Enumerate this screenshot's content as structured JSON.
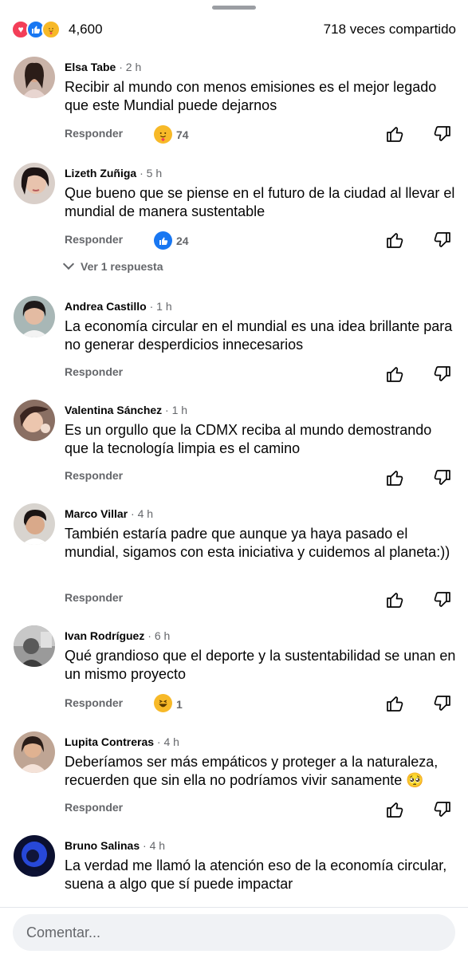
{
  "summary": {
    "reaction_total": "4,600",
    "shares": "718 veces compartido",
    "reaction_icons": [
      "love-icon",
      "like-icon",
      "care-icon"
    ]
  },
  "colors": {
    "like_blue": "#1877f2",
    "love_red": "#f33e58",
    "care_yellow": "#f7b928",
    "secondary_text": "#65676b"
  },
  "comments": [
    {
      "name": "Elsa Tabe",
      "time": "2 h",
      "text": "Recibir al mundo con menos emisiones es el mejor legado que este Mundial puede dejarnos",
      "reply": "Responder",
      "reaction_icon": "care-icon",
      "reaction_count": "74"
    },
    {
      "name": "Lizeth Zuñiga",
      "time": "5 h",
      "text": "Que bueno que se piense en el futuro de la ciudad al llevar el mundial de manera sustentable",
      "reply": "Responder",
      "reaction_icon": "like-icon",
      "reaction_count": "24",
      "replies_link": "Ver 1 respuesta"
    },
    {
      "name": "Andrea Castillo",
      "time": "1 h",
      "text": "La economía circular en el mundial es una idea brillante para no generar desperdicios innecesarios",
      "reply": "Responder"
    },
    {
      "name": "Valentina Sánchez",
      "time": "1 h",
      "text": "Es un orgullo que la CDMX reciba al mundo demostrando que la tecnología limpia es el camino",
      "reply": "Responder"
    },
    {
      "name": "Marco Villar",
      "time": "4 h",
      "text": "También estaría padre que aunque ya haya pasado el mundial, sigamos con esta iniciativa y cuidemos al planeta:))",
      "reply": "Responder"
    },
    {
      "name": "Ivan Rodríguez",
      "time": "6 h",
      "text": "Qué grandioso que el deporte y la sustentabilidad se unan en un mismo proyecto",
      "reply": "Responder",
      "reaction_icon": "haha-icon",
      "reaction_count": "1"
    },
    {
      "name": "Lupita Contreras",
      "time": "4 h",
      "text": "Deberíamos ser más empáticos y proteger a la naturaleza, recuerden que sin ella no podríamos vivir sanamente 🥺",
      "reply": "Responder"
    },
    {
      "name": "Bruno Salinas",
      "time": "4 h",
      "text": "La verdad me llamó la atención eso de la economía circular, suena a algo que sí puede impactar"
    }
  ],
  "composer": {
    "placeholder": "Comentar..."
  }
}
